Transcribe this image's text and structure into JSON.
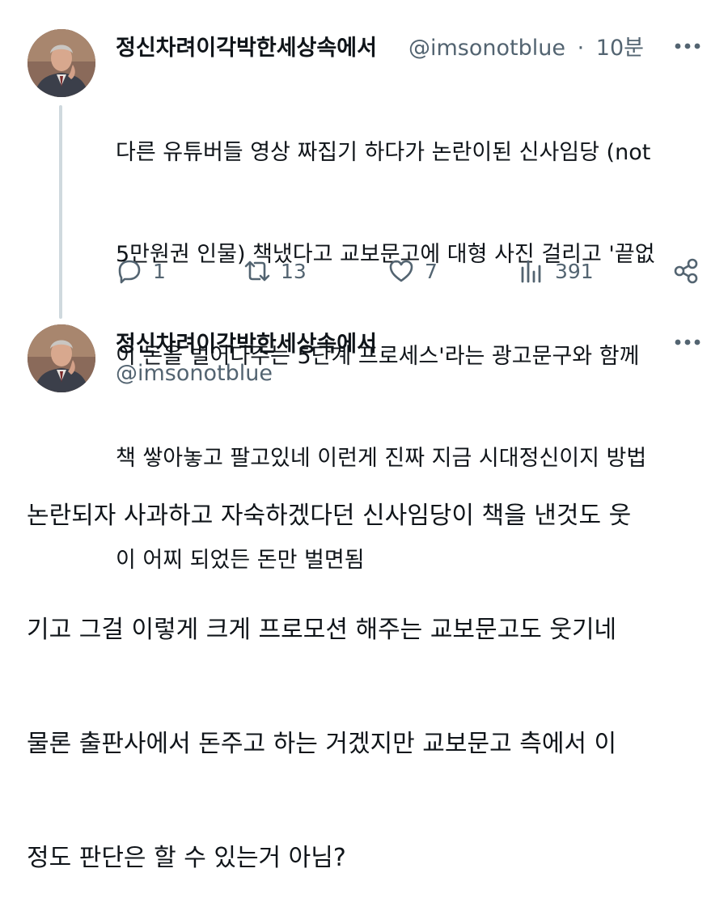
{
  "tweet": {
    "display_name": "정신차려이각박한세상속에서",
    "handle": "@imsonotblue",
    "separator": "·",
    "time": "10분",
    "text_lines": [
      "다른 유튜버들 영상 짜집기 하다가 논란이된 신사임당 (not",
      "5만원권 인물) 책냈다고 교보문고에 대형 사진 걸리고 '끝없",
      "이 돈을 벌어다주는 5단계 프로세스'라는 광고문구와 함께",
      "책 쌓아놓고 팔고있네 이런게 진짜 지금 시대정신이지 방법",
      "이 어찌 되었든 돈만 벌면됨"
    ],
    "actions": {
      "reply_count": "1",
      "retweet_count": "13",
      "like_count": "7",
      "views_count": "391"
    },
    "icons": [
      "reply-icon",
      "retweet-icon",
      "like-icon",
      "views-icon",
      "share-icon",
      "more-icon"
    ]
  },
  "reply_tweet": {
    "display_name": "정신차려이각박한세상속에서",
    "handle": "@imsonotblue",
    "text_lines": [
      "논란되자 사과하고 자숙하겠다던 신사임당이 책을 낸것도 웃",
      "기고 그걸 이렇게 크게 프로모션 해주는 교보문고도 웃기네",
      "물론 출판사에서 돈주고 하는 거겠지만 교보문고 측에서 이",
      "정도 판단은 할 수 있는거 아님?"
    ]
  },
  "colors": {
    "text_primary": "#0f1419",
    "text_secondary": "#536471",
    "thread_line": "#cfd9de",
    "background": "#ffffff"
  }
}
